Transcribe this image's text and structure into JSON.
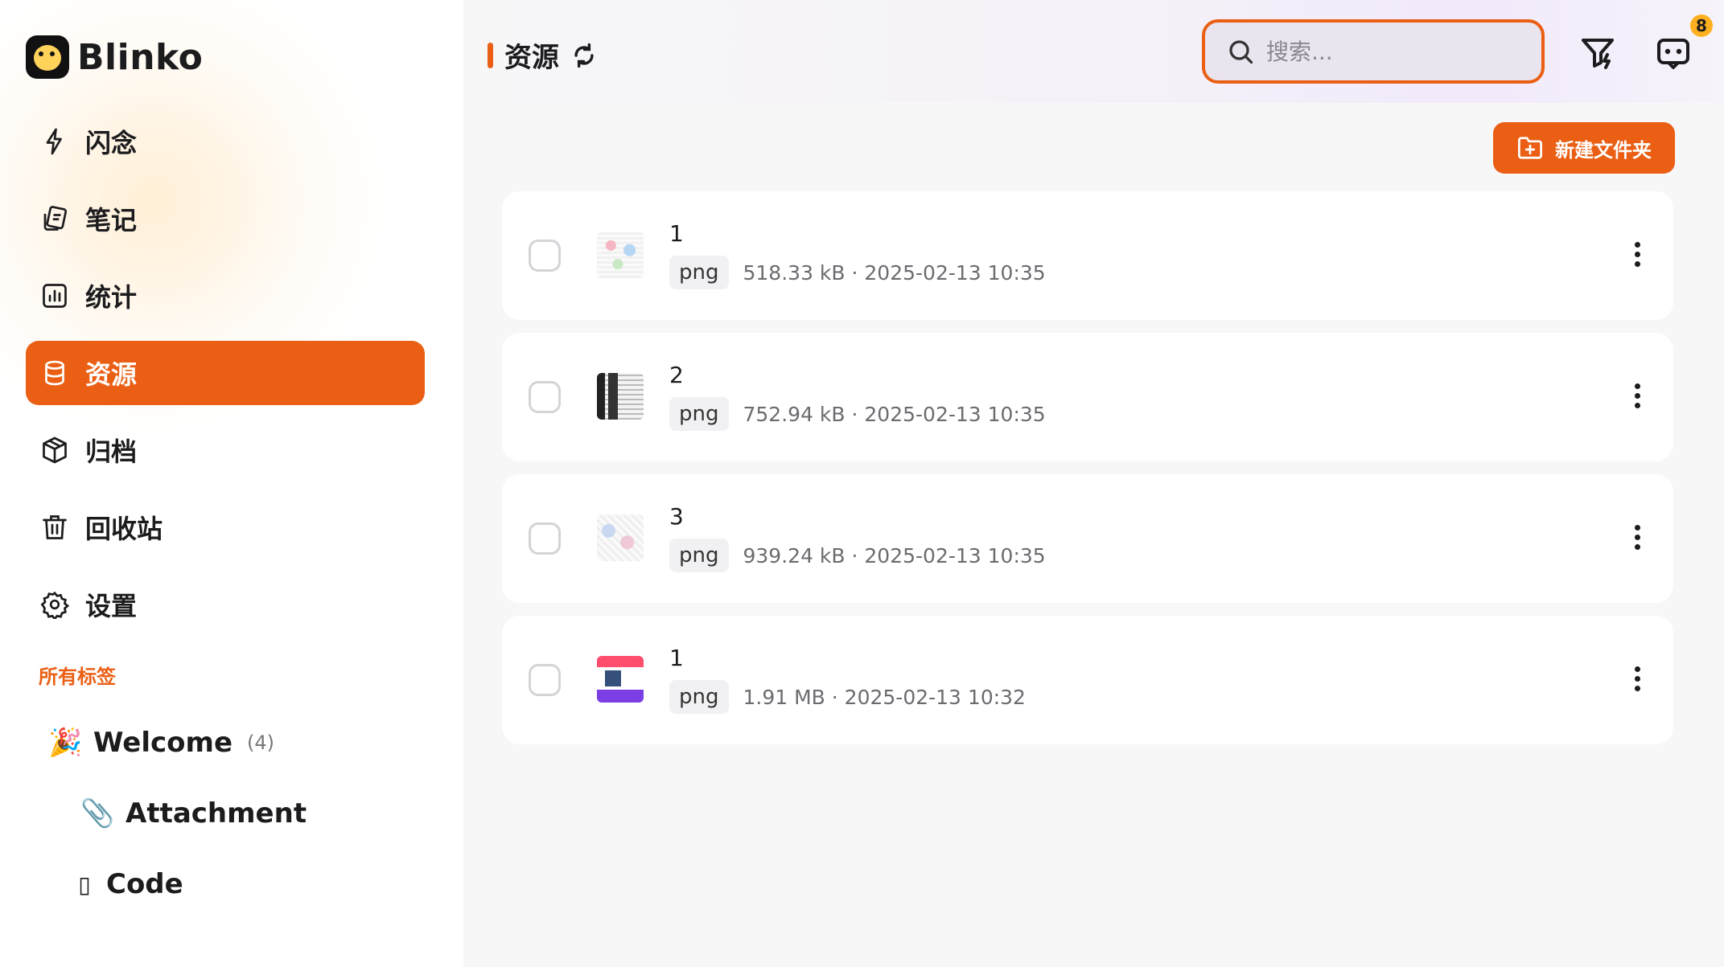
{
  "app": {
    "name": "Blinko"
  },
  "sidebar": {
    "items": [
      {
        "label": "闪念",
        "icon": "lightning-icon",
        "active": false
      },
      {
        "label": "笔记",
        "icon": "notes-icon",
        "active": false
      },
      {
        "label": "统计",
        "icon": "chart-icon",
        "active": false
      },
      {
        "label": "资源",
        "icon": "database-icon",
        "active": true
      },
      {
        "label": "归档",
        "icon": "archive-box-icon",
        "active": false
      },
      {
        "label": "回收站",
        "icon": "trash-icon",
        "active": false
      },
      {
        "label": "设置",
        "icon": "gear-icon",
        "active": false
      }
    ],
    "tags_title": "所有标签",
    "tags": [
      {
        "emoji": "🎉",
        "label": "Welcome",
        "count": "(4)"
      },
      {
        "emoji": "📎",
        "label": "Attachment"
      },
      {
        "emoji": "▯",
        "label": "Code"
      }
    ]
  },
  "header": {
    "title": "资源",
    "search_placeholder": "搜索...",
    "notification_count": "8"
  },
  "toolbar": {
    "new_folder_label": "新建文件夹"
  },
  "resources": [
    {
      "name": "1",
      "ext": "png",
      "info": "518.33 kB · 2025-02-13 10:35"
    },
    {
      "name": "2",
      "ext": "png",
      "info": "752.94 kB · 2025-02-13 10:35"
    },
    {
      "name": "3",
      "ext": "png",
      "info": "939.24 kB · 2025-02-13 10:35"
    },
    {
      "name": "1",
      "ext": "png",
      "info": "1.91 MB · 2025-02-13 10:32"
    }
  ],
  "colors": {
    "accent": "#ea5f14",
    "badge": "#ffb020"
  }
}
